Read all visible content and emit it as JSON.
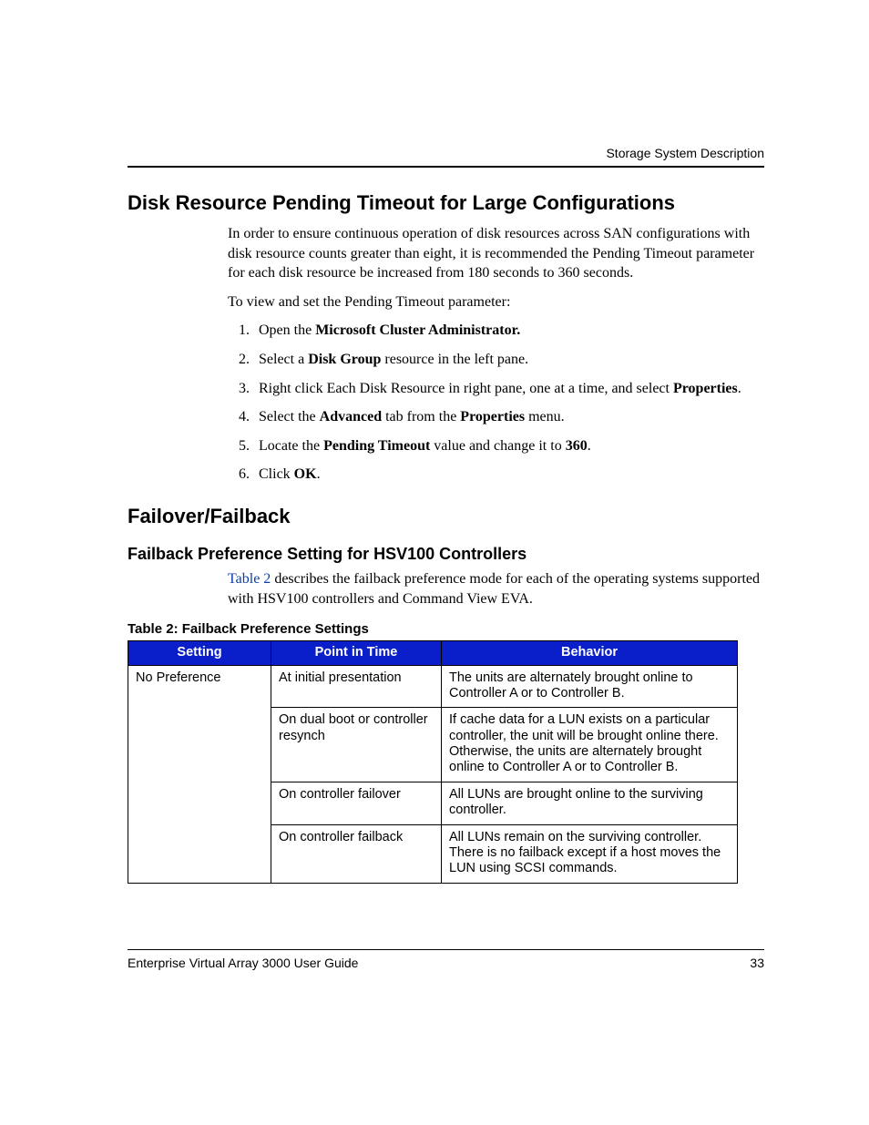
{
  "running_head": "Storage System Description",
  "section1": {
    "title": "Disk Resource Pending Timeout for Large Configurations",
    "intro": "In order to ensure continuous operation of disk resources across SAN configurations with disk resource counts greater than eight, it is recommended the Pending Timeout parameter for each disk resource be increased from 180 seconds to 360 seconds.",
    "lead": "To view and set the Pending Timeout parameter:",
    "steps": {
      "s1a": "Open the ",
      "s1b": "Microsoft Cluster Administrator.",
      "s2a": "Select a ",
      "s2b": "Disk Group",
      "s2c": " resource in the left pane.",
      "s3a": "Right click Each Disk Resource in right pane, one at a time, and select ",
      "s3b": "Properties",
      "s3c": ".",
      "s4a": "Select the ",
      "s4b": "Advanced",
      "s4c": " tab from the ",
      "s4d": "Properties",
      "s4e": " menu.",
      "s5a": "Locate the ",
      "s5b": "Pending Timeout",
      "s5c": " value and change it to ",
      "s5d": "360",
      "s5e": ".",
      "s6a": "Click ",
      "s6b": "OK",
      "s6c": "."
    }
  },
  "section2": {
    "title": "Failover/Failback",
    "sub_title": "Failback Preference Setting for HSV100 Controllers",
    "ref_link": "Table 2",
    "ref_rest": " describes the failback preference mode for each of the operating systems supported with HSV100 controllers and Command View EVA.",
    "table_caption": "Table 2:  Failback Preference Settings",
    "headers": {
      "setting": "Setting",
      "time": "Point in Time",
      "behavior": "Behavior"
    },
    "setting_cell": "No Preference",
    "rows": [
      {
        "time": "At initial presentation",
        "behavior": "The units are alternately brought online to Controller A or to Controller B."
      },
      {
        "time": "On dual boot or controller resynch",
        "behavior": "If cache data for a LUN exists on a particular controller, the unit will be brought online there. Otherwise, the units are alternately brought online to Controller A or to Controller B."
      },
      {
        "time": "On controller failover",
        "behavior": "All LUNs are brought online to the surviving controller."
      },
      {
        "time": "On controller failback",
        "behavior": "All LUNs remain on the surviving controller. There is no failback except if a host moves the LUN using SCSI commands."
      }
    ]
  },
  "footer": {
    "title": "Enterprise Virtual Array 3000 User Guide",
    "page": "33"
  }
}
